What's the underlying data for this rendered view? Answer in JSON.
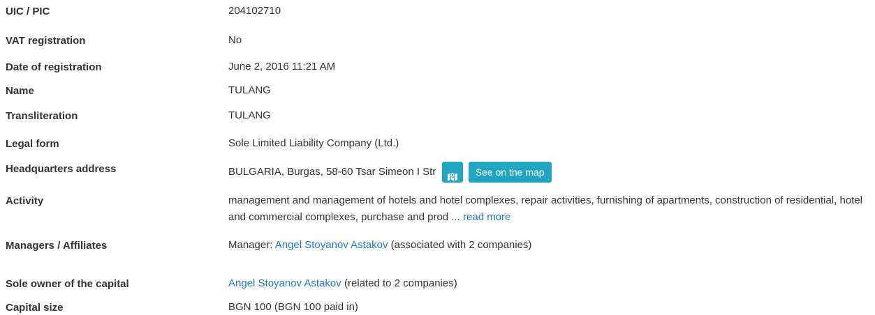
{
  "rows": {
    "uic": {
      "label": "UIC / PIC",
      "value": "204102710"
    },
    "vat": {
      "label": "VAT registration",
      "value": "No"
    },
    "date": {
      "label": "Date of registration",
      "value": "June 2, 2016 11:21 AM"
    },
    "name": {
      "label": "Name",
      "value": "TULANG"
    },
    "translit": {
      "label": "Transliteration",
      "value": "TULANG"
    },
    "legal": {
      "label": "Legal form",
      "value": "Sole Limited Liability Company (Ltd.)"
    },
    "hq": {
      "label": "Headquarters address",
      "value": "BULGARIA, Burgas, 58-60 Tsar Simeon I Str",
      "map_icon": "map-marker-icon",
      "map_button": "See on the map"
    },
    "activity": {
      "label": "Activity",
      "value": "management and management of hotels and hotel complexes, repair activities, furnishing of apartments, construction of residential, hotel and commercial complexes, purchase and prod ...",
      "more": "read more"
    },
    "managers": {
      "label": "Managers / Affiliates",
      "prefix": "Manager:",
      "person": "Angel Stoyanov Astakov",
      "suffix": "(associated with 2 companies)"
    },
    "owner": {
      "label": "Sole owner of the capital",
      "person": "Angel Stoyanov Astakov",
      "suffix": "(related to 2 companies)"
    },
    "capital": {
      "label": "Capital size",
      "value": "BGN 100 (BGN 100 paid in)"
    }
  },
  "colors": {
    "link": "#1e78c8",
    "button": "#22a5c1",
    "text": "#333333"
  }
}
